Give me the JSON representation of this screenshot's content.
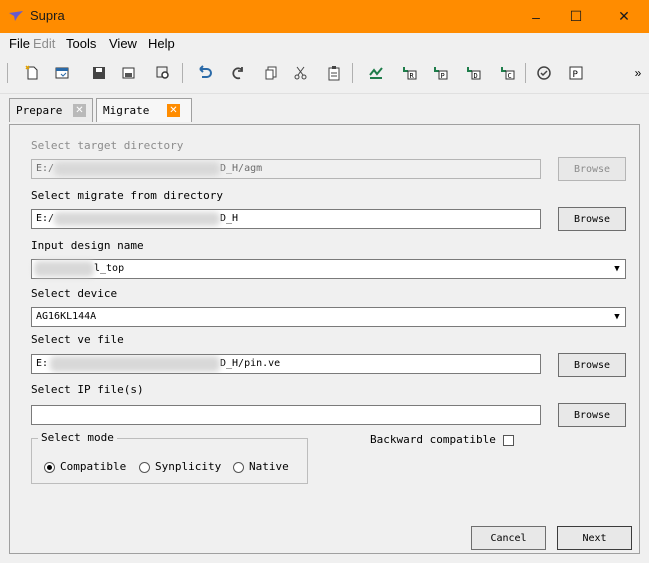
{
  "window": {
    "title": "Supra",
    "controls": {
      "minimize": "–",
      "maximize": "☐",
      "close": "✕"
    },
    "accent_color": "#ff8c00"
  },
  "menu": [
    {
      "label": "File",
      "disabled": false
    },
    {
      "label": "Edit",
      "disabled": true
    },
    {
      "label": "Tools",
      "disabled": false
    },
    {
      "label": "View",
      "disabled": false
    },
    {
      "label": "Help",
      "disabled": false
    }
  ],
  "toolbar": {
    "icons": [
      "new-file-icon",
      "open-icon",
      "save-icon",
      "save-as-icon",
      "settings-icon",
      "undo-icon",
      "redo-icon",
      "copy-icon",
      "cut-icon",
      "paste-icon",
      "compile-icon",
      "run-r-icon",
      "run-p-icon",
      "run-d-icon",
      "run-c-icon",
      "check-icon",
      "program-icon"
    ],
    "overflow": "»"
  },
  "tabs": [
    {
      "label": "Prepare",
      "close": "✕",
      "active": false
    },
    {
      "label": "Migrate",
      "close": "✕",
      "active": true
    }
  ],
  "form": {
    "target_dir_label": "Select target directory",
    "target_dir_prefix": "E:/",
    "target_dir_suffix": "D_H/agm",
    "migrate_from_label": "Select migrate from directory",
    "migrate_from_prefix": "E:/",
    "migrate_from_suffix": "D_H",
    "design_name_label": "Input design name",
    "design_name_value": "l_top",
    "device_label": "Select device",
    "device_value": "AG16KL144A",
    "ve_file_label": "Select ve file",
    "ve_file_prefix": "E:",
    "ve_file_suffix": "D_H/pin.ve",
    "ip_files_label": "Select IP file(s)",
    "ip_files_value": "",
    "browse": "Browse",
    "combo_arrow": "▼"
  },
  "mode": {
    "group_label": "Select mode",
    "options": [
      {
        "label": "Compatible",
        "selected": true
      },
      {
        "label": "Synplicity",
        "selected": false
      },
      {
        "label": "Native",
        "selected": false
      }
    ]
  },
  "backward_compatible": {
    "label": "Backward compatible",
    "checked": false
  },
  "buttons": {
    "cancel": "Cancel",
    "next": "Next"
  }
}
